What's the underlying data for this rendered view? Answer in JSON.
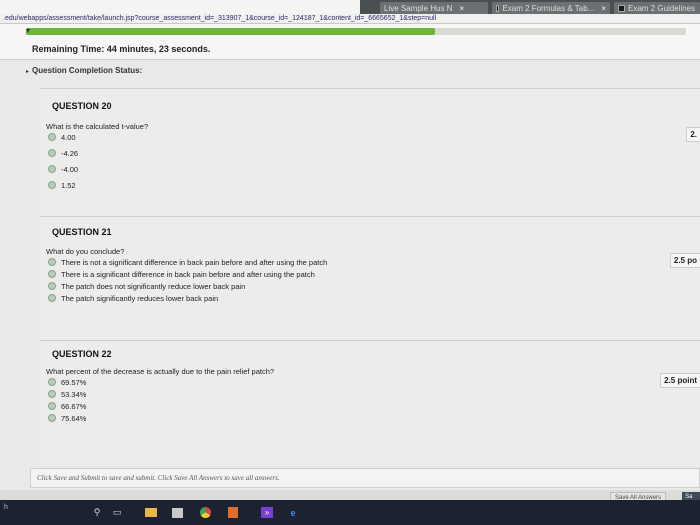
{
  "browser": {
    "url": ".edu/webapps/assessment/take/launch.jsp?course_assessment_id=_313907_1&course_id=_124187_1&content_id=_6665652_1&step=null",
    "tabs": [
      {
        "label": "Live Sample Hus N",
        "close": "×"
      },
      {
        "label": "Exam 2 Formulas & Tab...",
        "close": "×"
      },
      {
        "label": "Exam 2 Guidelines"
      }
    ]
  },
  "timer": {
    "label": "Remaining Time: 44 minutes, 23 seconds.",
    "progress": 0.62
  },
  "status": {
    "label": "Question Completion Status:"
  },
  "questions": [
    {
      "title": "QUESTION 20",
      "text": "What is the calculated t-value?",
      "points": "2.",
      "options": [
        "4.00",
        "-4.26",
        "-4.00",
        "1.52"
      ]
    },
    {
      "title": "QUESTION 21",
      "text": "What do you conclude?",
      "points": "2.5 po",
      "options": [
        "There is not a significant difference in back pain before and after using the patch",
        "There is a significant difference in back pain before and after using the patch",
        "The patch does not significantly reduce lower back pain",
        "The patch significantly reduces lower back pain"
      ]
    },
    {
      "title": "QUESTION 22",
      "text": "What percent of the decrease is actually due to the pain relief patch?",
      "points": "2.5 point",
      "options": [
        "69.57%",
        "53.34%",
        "66.67%",
        "75.64%"
      ]
    }
  ],
  "footer": {
    "note": "Click Save and Submit to save and submit. Click Save All Answers to save all answers.",
    "save_all": "Save All Answers",
    "submit": "Sa"
  },
  "taskbar": {
    "left_text": "h"
  }
}
